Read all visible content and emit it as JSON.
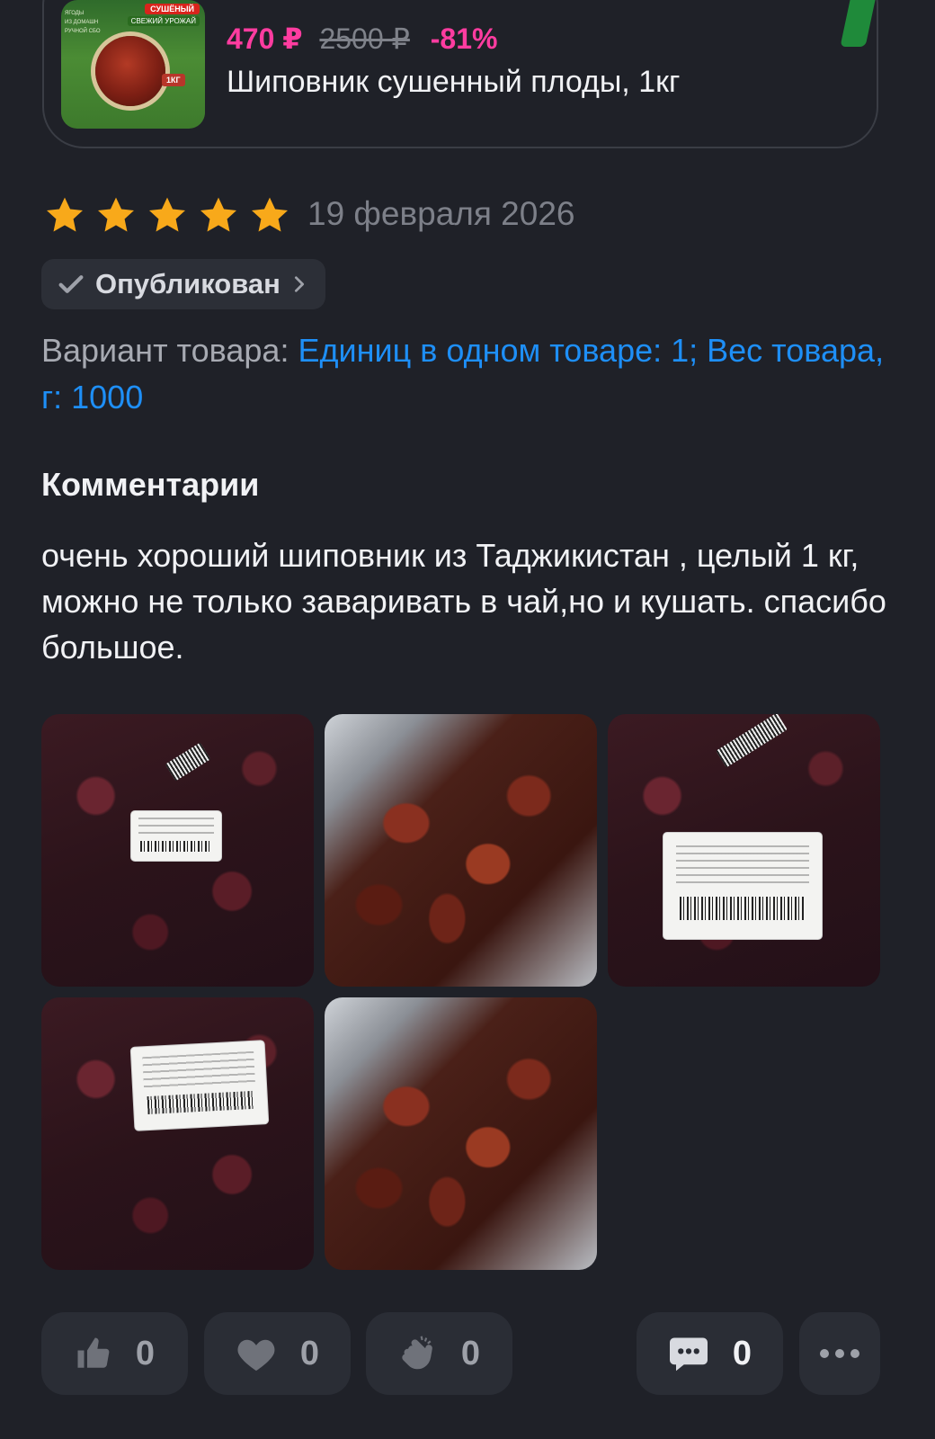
{
  "product": {
    "thumbnail": {
      "badge": "СУШЁНЫЙ",
      "sub_badge": "СВЕЖИЙ УРОЖАЙ",
      "weight": "1КГ",
      "side_text": [
        "ЯГОДЫ",
        "ИЗ ДОМАШН",
        "РУЧНОЙ СБО"
      ]
    },
    "price_current": "470 ₽",
    "price_old": "2500 ₽",
    "discount": "-81%",
    "title": "Шиповник сушенный плоды, 1кг"
  },
  "review": {
    "rating": 5,
    "date": "19 февраля 2026",
    "status": "Опубликован",
    "variant_label": "Вариант товара:",
    "variant_value": "Единиц в одном товаре: 1; Вес товара, г: 1000",
    "comments_heading": "Комментарии",
    "comment_text": "очень хороший шиповник из Таджикистан , целый 1 кг, можно не только заваривать в чай,но и кушать. спасибо большое.",
    "photos_count": 5
  },
  "photos": [
    {
      "label": "Шиповник сушеный 1кг"
    },
    {
      "label": ""
    },
    {
      "label": "Шиповник сушеный 1кг · Дата производства: 02.02.2026 · Срок годности: 12 месяцев · Страна: Таджикистан"
    },
    {
      "label": "Шиповник сушеный 1кг · Дата производства: 02.02.2026 · Страна: Таджикистан"
    },
    {
      "label": ""
    }
  ],
  "actions": {
    "like_count": "0",
    "heart_count": "0",
    "clap_count": "0",
    "comment_count": "0"
  },
  "colors": {
    "background": "#1f2128",
    "price_accent": "#ff3ca0",
    "link_blue": "#1e8ff7",
    "star_orange": "#f8a91a"
  }
}
